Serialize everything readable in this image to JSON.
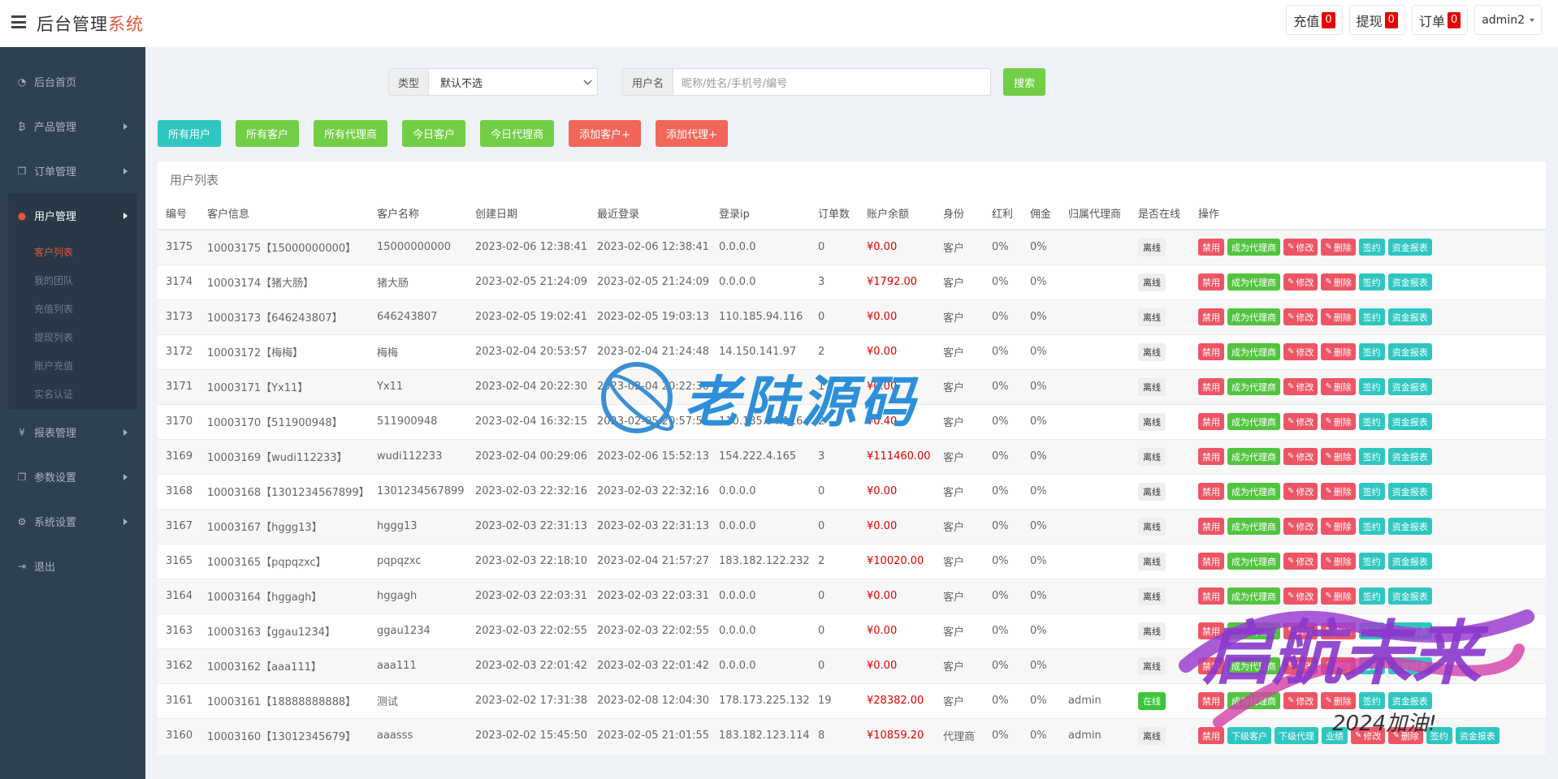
{
  "header": {
    "brand_main": "后台管理",
    "brand_accent": "系统",
    "badges": [
      {
        "label": "充值",
        "count": "0"
      },
      {
        "label": "提现",
        "count": "0"
      },
      {
        "label": "订单",
        "count": "0"
      }
    ],
    "user": "admin2"
  },
  "sidebar": {
    "items": [
      {
        "label": "后台首页",
        "icon": "dashboard-icon"
      },
      {
        "label": "产品管理",
        "icon": "bitcoin-icon"
      },
      {
        "label": "订单管理",
        "icon": "copy-icon"
      },
      {
        "label": "用户管理",
        "icon": "user-icon"
      },
      {
        "label": "报表管理",
        "icon": "yen-icon"
      },
      {
        "label": "参数设置",
        "icon": "copy-icon"
      },
      {
        "label": "系统设置",
        "icon": "gears-icon"
      },
      {
        "label": "退出",
        "icon": "sign-out-icon"
      }
    ],
    "sub_items": [
      "客户列表",
      "我的团队",
      "充值列表",
      "提现列表",
      "账户充值",
      "实名认证"
    ]
  },
  "search": {
    "type_label": "类型",
    "type_value": "默认不选",
    "user_label": "用户名",
    "user_placeholder": "昵称/姓名/手机号/编号",
    "button": "搜索"
  },
  "filters": [
    "所有用户",
    "所有客户",
    "所有代理商",
    "今日客户",
    "今日代理商",
    "添加客户+",
    "添加代理+"
  ],
  "panel": {
    "title": "用户列表",
    "columns": [
      "编号",
      "客户信息",
      "客户名称",
      "创建日期",
      "最近登录",
      "登录ip",
      "订单数",
      "账户余额",
      "身份",
      "红利",
      "佣金",
      "归属代理商",
      "是否在线",
      "操作"
    ],
    "rows": [
      {
        "id": "3175",
        "info": "10003175【15000000000】",
        "name": "15000000000",
        "created": "2023-02-06 12:38:41",
        "last": "2023-02-06 12:38:41",
        "ip": "0.0.0.0",
        "orders": "0",
        "balance": "¥0.00",
        "role": "客户",
        "bonus": "0%",
        "comm": "0%",
        "agent": "",
        "online": "离线"
      },
      {
        "id": "3174",
        "info": "10003174【猪大肠】",
        "name": "猪大肠",
        "created": "2023-02-05 21:24:09",
        "last": "2023-02-05 21:24:09",
        "ip": "0.0.0.0",
        "orders": "3",
        "balance": "¥1792.00",
        "role": "客户",
        "bonus": "0%",
        "comm": "0%",
        "agent": "",
        "online": "离线"
      },
      {
        "id": "3173",
        "info": "10003173【646243807】",
        "name": "646243807",
        "created": "2023-02-05 19:02:41",
        "last": "2023-02-05 19:03:13",
        "ip": "110.185.94.116",
        "orders": "0",
        "balance": "¥0.00",
        "role": "客户",
        "bonus": "0%",
        "comm": "0%",
        "agent": "",
        "online": "离线"
      },
      {
        "id": "3172",
        "info": "10003172【梅梅】",
        "name": "梅梅",
        "created": "2023-02-04 20:53:57",
        "last": "2023-02-04 21:24:48",
        "ip": "14.150.141.97",
        "orders": "2",
        "balance": "¥0.00",
        "role": "客户",
        "bonus": "0%",
        "comm": "0%",
        "agent": "",
        "online": "离线"
      },
      {
        "id": "3171",
        "info": "10003171【Yx11】",
        "name": "Yx11",
        "created": "2023-02-04 20:22:30",
        "last": "2023-02-04 20:22:30",
        "ip": "",
        "orders": "1",
        "balance": "¥0.00",
        "role": "客户",
        "bonus": "0%",
        "comm": "0%",
        "agent": "",
        "online": "离线"
      },
      {
        "id": "3170",
        "info": "10003170【511900948】",
        "name": "511900948",
        "created": "2023-02-04 16:32:15",
        "last": "2023-02-05 20:57:55",
        "ip": "110.185.94.116",
        "orders": "2",
        "balance": "¥0.40",
        "role": "客户",
        "bonus": "0%",
        "comm": "0%",
        "agent": "",
        "online": "离线"
      },
      {
        "id": "3169",
        "info": "10003169【wudi112233】",
        "name": "wudi112233",
        "created": "2023-02-04 00:29:06",
        "last": "2023-02-06 15:52:13",
        "ip": "154.222.4.165",
        "orders": "3",
        "balance": "¥111460.00",
        "role": "客户",
        "bonus": "0%",
        "comm": "0%",
        "agent": "",
        "online": "离线"
      },
      {
        "id": "3168",
        "info": "10003168【1301234567899】",
        "name": "1301234567899",
        "created": "2023-02-03 22:32:16",
        "last": "2023-02-03 22:32:16",
        "ip": "0.0.0.0",
        "orders": "0",
        "balance": "¥0.00",
        "role": "客户",
        "bonus": "0%",
        "comm": "0%",
        "agent": "",
        "online": "离线"
      },
      {
        "id": "3167",
        "info": "10003167【hggg13】",
        "name": "hggg13",
        "created": "2023-02-03 22:31:13",
        "last": "2023-02-03 22:31:13",
        "ip": "0.0.0.0",
        "orders": "0",
        "balance": "¥0.00",
        "role": "客户",
        "bonus": "0%",
        "comm": "0%",
        "agent": "",
        "online": "离线"
      },
      {
        "id": "3165",
        "info": "10003165【pqpqzxc】",
        "name": "pqpqzxc",
        "created": "2023-02-03 22:18:10",
        "last": "2023-02-04 21:57:27",
        "ip": "183.182.122.232",
        "orders": "2",
        "balance": "¥10020.00",
        "role": "客户",
        "bonus": "0%",
        "comm": "0%",
        "agent": "",
        "online": "离线"
      },
      {
        "id": "3164",
        "info": "10003164【hggagh】",
        "name": "hggagh",
        "created": "2023-02-03 22:03:31",
        "last": "2023-02-03 22:03:31",
        "ip": "0.0.0.0",
        "orders": "0",
        "balance": "¥0.00",
        "role": "客户",
        "bonus": "0%",
        "comm": "0%",
        "agent": "",
        "online": "离线"
      },
      {
        "id": "3163",
        "info": "10003163【ggau1234】",
        "name": "ggau1234",
        "created": "2023-02-03 22:02:55",
        "last": "2023-02-03 22:02:55",
        "ip": "0.0.0.0",
        "orders": "0",
        "balance": "¥0.00",
        "role": "客户",
        "bonus": "0%",
        "comm": "0%",
        "agent": "",
        "online": "离线"
      },
      {
        "id": "3162",
        "info": "10003162【aaa111】",
        "name": "aaa111",
        "created": "2023-02-03 22:01:42",
        "last": "2023-02-03 22:01:42",
        "ip": "0.0.0.0",
        "orders": "0",
        "balance": "¥0.00",
        "role": "客户",
        "bonus": "0%",
        "comm": "0%",
        "agent": "",
        "online": "离线"
      },
      {
        "id": "3161",
        "info": "10003161【18888888888】",
        "name": "测试",
        "created": "2023-02-02 17:31:38",
        "last": "2023-02-08 12:04:30",
        "ip": "178.173.225.132",
        "orders": "19",
        "balance": "¥28382.00",
        "role": "客户",
        "bonus": "0%",
        "comm": "0%",
        "agent": "admin",
        "online": "在线"
      },
      {
        "id": "3160",
        "info": "10003160【13012345679】",
        "name": "aaasss",
        "created": "2023-02-02 15:45:50",
        "last": "2023-02-05 21:01:55",
        "ip": "183.182.123.114",
        "orders": "8",
        "balance": "¥10859.20",
        "role": "代理商",
        "bonus": "0%",
        "comm": "0%",
        "agent": "admin",
        "online": "离线"
      }
    ],
    "actions_client": [
      {
        "label": "禁用",
        "color": "red"
      },
      {
        "label": "成为代理商",
        "color": "green"
      },
      {
        "label": "修改",
        "color": "red",
        "icon": "pencil-icon"
      },
      {
        "label": "删除",
        "color": "red",
        "icon": "pencil-icon"
      },
      {
        "label": "签约",
        "color": "teal"
      },
      {
        "label": "资金报表",
        "color": "teal"
      }
    ],
    "actions_agent": [
      {
        "label": "禁用",
        "color": "red"
      },
      {
        "label": "下级客户",
        "color": "teal"
      },
      {
        "label": "下级代理",
        "color": "teal"
      },
      {
        "label": "业绩",
        "color": "teal"
      },
      {
        "label": "修改",
        "color": "red",
        "icon": "pencil-icon"
      },
      {
        "label": "删除",
        "color": "red",
        "icon": "pencil-icon"
      },
      {
        "label": "签约",
        "color": "teal"
      },
      {
        "label": "资金报表",
        "color": "teal"
      }
    ]
  },
  "watermark": {
    "text1": "老陆源码",
    "text2": "启航未来",
    "text3": "2024加油!"
  }
}
